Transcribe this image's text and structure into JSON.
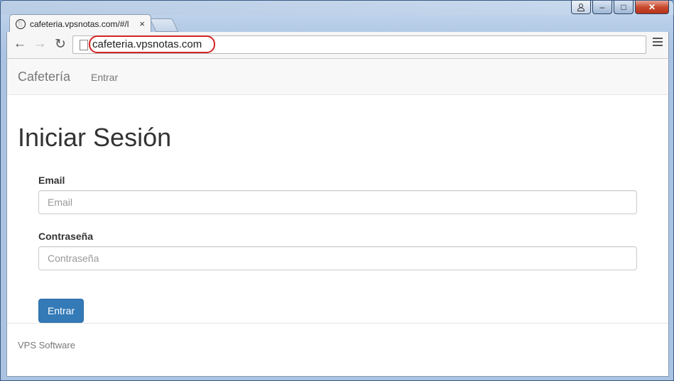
{
  "browser": {
    "tab_title": "cafeteria.vpsnotas.com/#/l",
    "tab_close": "×",
    "address": "cafeteria.vpsnotas.com",
    "window_controls": {
      "minimize": "–",
      "maximize": "□",
      "close": "✕"
    },
    "nav": {
      "back": "←",
      "forward": "→",
      "reload": "↻"
    }
  },
  "navbar": {
    "brand": "Cafetería",
    "link": "Entrar"
  },
  "form": {
    "heading": "Iniciar Sesión",
    "email_label": "Email",
    "email_placeholder": "Email",
    "password_label": "Contraseña",
    "password_placeholder": "Contraseña",
    "submit_label": "Entrar"
  },
  "footer": {
    "text": "VPS Software"
  },
  "colors": {
    "primary_button": "#337ab7",
    "url_highlight": "#d42323"
  }
}
